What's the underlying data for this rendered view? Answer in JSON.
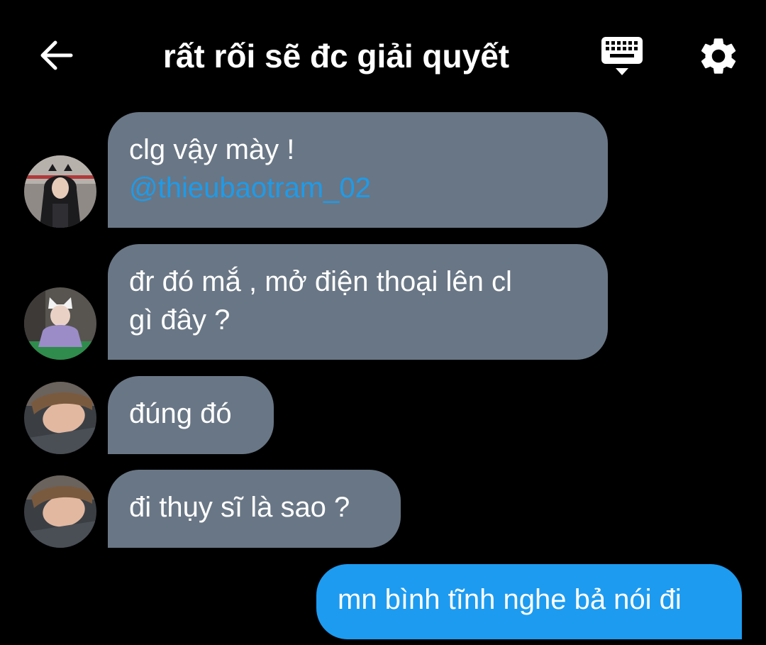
{
  "header": {
    "title": "rất rối sẽ đc giải quyết",
    "back_icon": "arrow-left-icon",
    "keyboard_icon": "keyboard-icon",
    "settings_icon": "gear-icon"
  },
  "messages": [
    {
      "direction": "in",
      "lines": [
        "clg vậy mày !"
      ],
      "mention": "@thieubaotram_02",
      "avatar": "avatar-girl-black-hood"
    },
    {
      "direction": "in",
      "lines": [
        "đr đó mắ , mở điện thoại lên cl",
        "gì đây ?"
      ],
      "avatar": "avatar-girl-cat-hat"
    },
    {
      "direction": "in",
      "lines": [
        "đúng đó"
      ],
      "avatar": "avatar-girl-lying"
    },
    {
      "direction": "in",
      "lines": [
        "đi thụy sĩ là sao ?"
      ],
      "avatar": "avatar-girl-lying"
    },
    {
      "direction": "out",
      "lines": [
        "mn bình tĩnh nghe bả nói đi"
      ]
    }
  ],
  "colors": {
    "background": "#000000",
    "incoming_bubble": "#697685",
    "outgoing_bubble": "#1d9bf0",
    "mention": "#1e9be9"
  }
}
